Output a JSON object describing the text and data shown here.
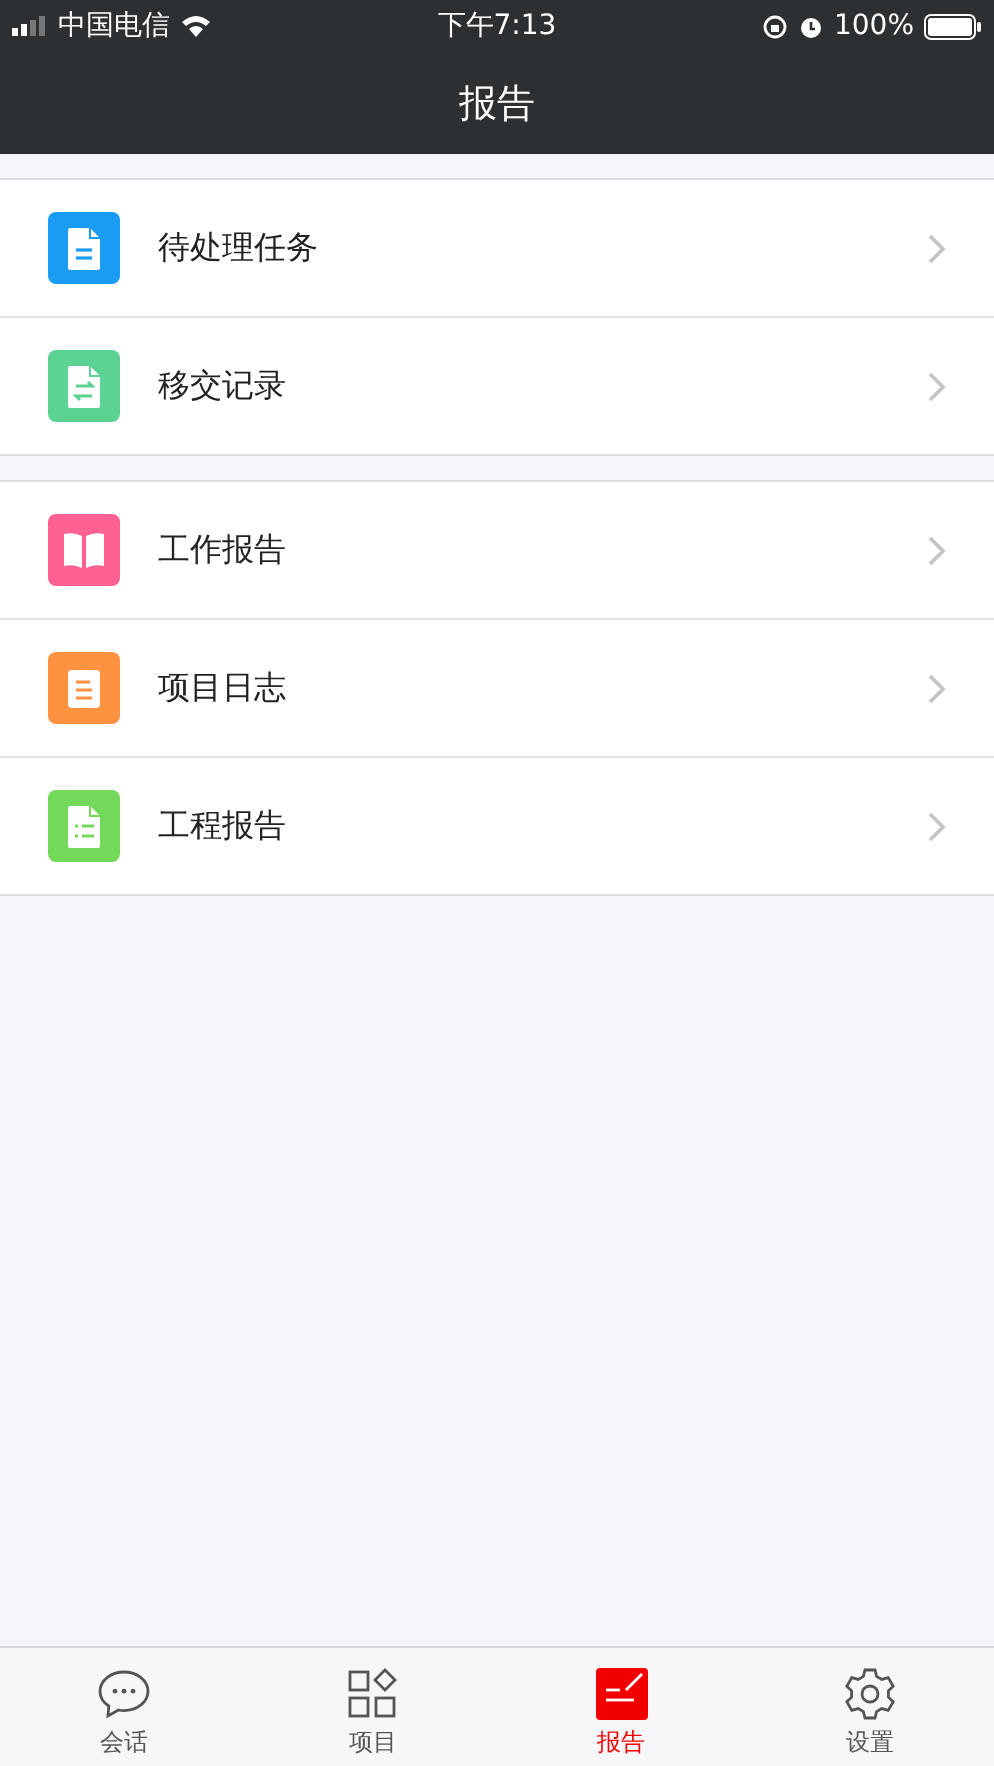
{
  "status_bar": {
    "carrier": "中国电信",
    "time": "下午7:13",
    "battery": "100%"
  },
  "nav_bar": {
    "title": "报告"
  },
  "groups": [
    {
      "items": [
        {
          "label": "待处理任务",
          "kind": "doc",
          "color": "#1a9cf5"
        },
        {
          "label": "移交记录",
          "kind": "transfer",
          "color": "#5dd393"
        }
      ]
    },
    {
      "items": [
        {
          "label": "工作报告",
          "kind": "book",
          "color": "#fd6191"
        },
        {
          "label": "项目日志",
          "kind": "note",
          "color": "#fe9241"
        },
        {
          "label": "工程报告",
          "kind": "list",
          "color": "#74d85a"
        }
      ]
    }
  ],
  "tab_bar": [
    {
      "label": "会话",
      "kind": "chat",
      "selected": false
    },
    {
      "label": "项目",
      "kind": "grid",
      "selected": false
    },
    {
      "label": "报告",
      "kind": "report",
      "selected": true
    },
    {
      "label": "设置",
      "kind": "gear",
      "selected": false
    }
  ]
}
